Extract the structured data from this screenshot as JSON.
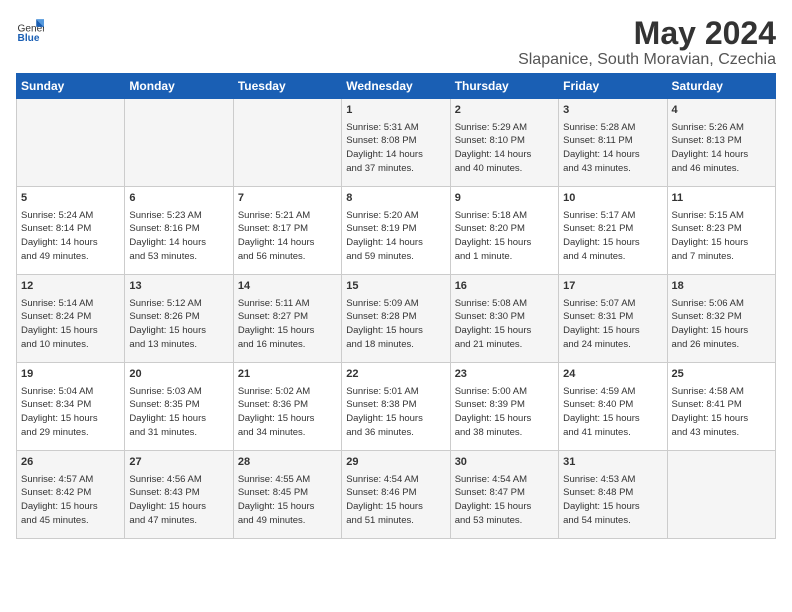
{
  "header": {
    "logo_general": "General",
    "logo_blue": "Blue",
    "title": "May 2024",
    "subtitle": "Slapanice, South Moravian, Czechia"
  },
  "days_of_week": [
    "Sunday",
    "Monday",
    "Tuesday",
    "Wednesday",
    "Thursday",
    "Friday",
    "Saturday"
  ],
  "weeks": [
    [
      {
        "day": "",
        "info": ""
      },
      {
        "day": "",
        "info": ""
      },
      {
        "day": "",
        "info": ""
      },
      {
        "day": "1",
        "info": "Sunrise: 5:31 AM\nSunset: 8:08 PM\nDaylight: 14 hours\nand 37 minutes."
      },
      {
        "day": "2",
        "info": "Sunrise: 5:29 AM\nSunset: 8:10 PM\nDaylight: 14 hours\nand 40 minutes."
      },
      {
        "day": "3",
        "info": "Sunrise: 5:28 AM\nSunset: 8:11 PM\nDaylight: 14 hours\nand 43 minutes."
      },
      {
        "day": "4",
        "info": "Sunrise: 5:26 AM\nSunset: 8:13 PM\nDaylight: 14 hours\nand 46 minutes."
      }
    ],
    [
      {
        "day": "5",
        "info": "Sunrise: 5:24 AM\nSunset: 8:14 PM\nDaylight: 14 hours\nand 49 minutes."
      },
      {
        "day": "6",
        "info": "Sunrise: 5:23 AM\nSunset: 8:16 PM\nDaylight: 14 hours\nand 53 minutes."
      },
      {
        "day": "7",
        "info": "Sunrise: 5:21 AM\nSunset: 8:17 PM\nDaylight: 14 hours\nand 56 minutes."
      },
      {
        "day": "8",
        "info": "Sunrise: 5:20 AM\nSunset: 8:19 PM\nDaylight: 14 hours\nand 59 minutes."
      },
      {
        "day": "9",
        "info": "Sunrise: 5:18 AM\nSunset: 8:20 PM\nDaylight: 15 hours\nand 1 minute."
      },
      {
        "day": "10",
        "info": "Sunrise: 5:17 AM\nSunset: 8:21 PM\nDaylight: 15 hours\nand 4 minutes."
      },
      {
        "day": "11",
        "info": "Sunrise: 5:15 AM\nSunset: 8:23 PM\nDaylight: 15 hours\nand 7 minutes."
      }
    ],
    [
      {
        "day": "12",
        "info": "Sunrise: 5:14 AM\nSunset: 8:24 PM\nDaylight: 15 hours\nand 10 minutes."
      },
      {
        "day": "13",
        "info": "Sunrise: 5:12 AM\nSunset: 8:26 PM\nDaylight: 15 hours\nand 13 minutes."
      },
      {
        "day": "14",
        "info": "Sunrise: 5:11 AM\nSunset: 8:27 PM\nDaylight: 15 hours\nand 16 minutes."
      },
      {
        "day": "15",
        "info": "Sunrise: 5:09 AM\nSunset: 8:28 PM\nDaylight: 15 hours\nand 18 minutes."
      },
      {
        "day": "16",
        "info": "Sunrise: 5:08 AM\nSunset: 8:30 PM\nDaylight: 15 hours\nand 21 minutes."
      },
      {
        "day": "17",
        "info": "Sunrise: 5:07 AM\nSunset: 8:31 PM\nDaylight: 15 hours\nand 24 minutes."
      },
      {
        "day": "18",
        "info": "Sunrise: 5:06 AM\nSunset: 8:32 PM\nDaylight: 15 hours\nand 26 minutes."
      }
    ],
    [
      {
        "day": "19",
        "info": "Sunrise: 5:04 AM\nSunset: 8:34 PM\nDaylight: 15 hours\nand 29 minutes."
      },
      {
        "day": "20",
        "info": "Sunrise: 5:03 AM\nSunset: 8:35 PM\nDaylight: 15 hours\nand 31 minutes."
      },
      {
        "day": "21",
        "info": "Sunrise: 5:02 AM\nSunset: 8:36 PM\nDaylight: 15 hours\nand 34 minutes."
      },
      {
        "day": "22",
        "info": "Sunrise: 5:01 AM\nSunset: 8:38 PM\nDaylight: 15 hours\nand 36 minutes."
      },
      {
        "day": "23",
        "info": "Sunrise: 5:00 AM\nSunset: 8:39 PM\nDaylight: 15 hours\nand 38 minutes."
      },
      {
        "day": "24",
        "info": "Sunrise: 4:59 AM\nSunset: 8:40 PM\nDaylight: 15 hours\nand 41 minutes."
      },
      {
        "day": "25",
        "info": "Sunrise: 4:58 AM\nSunset: 8:41 PM\nDaylight: 15 hours\nand 43 minutes."
      }
    ],
    [
      {
        "day": "26",
        "info": "Sunrise: 4:57 AM\nSunset: 8:42 PM\nDaylight: 15 hours\nand 45 minutes."
      },
      {
        "day": "27",
        "info": "Sunrise: 4:56 AM\nSunset: 8:43 PM\nDaylight: 15 hours\nand 47 minutes."
      },
      {
        "day": "28",
        "info": "Sunrise: 4:55 AM\nSunset: 8:45 PM\nDaylight: 15 hours\nand 49 minutes."
      },
      {
        "day": "29",
        "info": "Sunrise: 4:54 AM\nSunset: 8:46 PM\nDaylight: 15 hours\nand 51 minutes."
      },
      {
        "day": "30",
        "info": "Sunrise: 4:54 AM\nSunset: 8:47 PM\nDaylight: 15 hours\nand 53 minutes."
      },
      {
        "day": "31",
        "info": "Sunrise: 4:53 AM\nSunset: 8:48 PM\nDaylight: 15 hours\nand 54 minutes."
      },
      {
        "day": "",
        "info": ""
      }
    ]
  ]
}
